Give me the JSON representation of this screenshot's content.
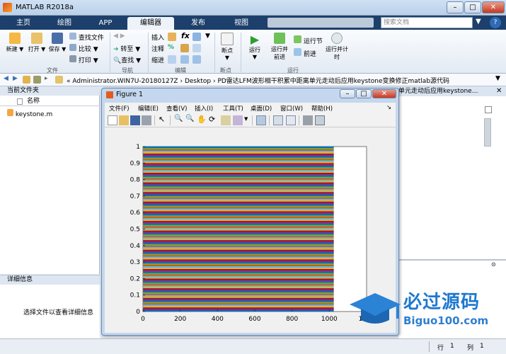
{
  "window": {
    "title": "MATLAB R2018a"
  },
  "tabs": [
    "主页",
    "绘图",
    "APP",
    "编辑器",
    "发布",
    "视图"
  ],
  "search": {
    "placeholder": "搜索文档"
  },
  "ribbon": {
    "file": {
      "new": "新建",
      "open": "打开",
      "save": "保存",
      "find_files": "查找文件",
      "compare": "比较",
      "print": "打印",
      "group": "文件"
    },
    "nav": {
      "goto": "转至",
      "find": "查找",
      "group": "导航"
    },
    "edit": {
      "insert": "插入",
      "fx": "fx",
      "comment": "注释",
      "indent": "缩进",
      "group": "编辑"
    },
    "breakpoints": {
      "label": "断点",
      "group": "断点"
    },
    "run": {
      "run": "运行",
      "run_adv": "运行并前进",
      "run_section": "运行节",
      "advance": "前进",
      "run_time": "运行并计时",
      "group": "运行"
    }
  },
  "address": {
    "path": [
      "«",
      "Administrator.WIN7U-20180127Z",
      "›",
      "Desktop",
      "›",
      "PD雷达LFM波形相干积累中距离单元走动后应用keystone变换修正matlab源代码"
    ]
  },
  "left_panel": {
    "title": "当前文件夹",
    "col_name": "名称",
    "files": [
      "keystone.m"
    ]
  },
  "details": {
    "title": "详细信息",
    "empty_text": "选择文件以查看详细信息"
  },
  "right_panel": {
    "title_fragment": "单元走动后应用keystone..."
  },
  "figure": {
    "title": "Figure 1",
    "menu": [
      "文件(F)",
      "编辑(E)",
      "查看(V)",
      "插入(I)",
      "工具(T)",
      "桌面(D)",
      "窗口(W)",
      "帮助(H)"
    ]
  },
  "chart_data": {
    "type": "line",
    "description_series_count_approx": 120,
    "title": "",
    "xlabel": "",
    "ylabel": "",
    "xlim": [
      0,
      1200
    ],
    "ylim": [
      0,
      1
    ],
    "x_ticks": [
      0,
      200,
      400,
      600,
      800,
      1000,
      1200
    ],
    "y_ticks": [
      0,
      0.1,
      0.2,
      0.3,
      0.4,
      0.5,
      0.6,
      0.7,
      0.8,
      0.9,
      1
    ],
    "x_tick_labels": [
      "0",
      "200",
      "400",
      "600",
      "800",
      "1000",
      "1200"
    ],
    "y_tick_labels": [
      "0",
      "0.1",
      "0.2",
      "0.3",
      "0.4",
      "0.5",
      "0.6",
      "0.7",
      "0.8",
      "0.9",
      "1"
    ],
    "data_x_range": [
      1,
      1024
    ],
    "series_colors": [
      "#0072bd",
      "#d95319",
      "#edb120",
      "#7e2f8e",
      "#77ac30",
      "#4dbeee",
      "#a2142f"
    ],
    "grid": false
  },
  "status": {
    "row_label": "行",
    "row": "1",
    "col_label": "列",
    "col": "1"
  },
  "watermark": {
    "name": "必过源码",
    "url": "Biguo100.com"
  }
}
